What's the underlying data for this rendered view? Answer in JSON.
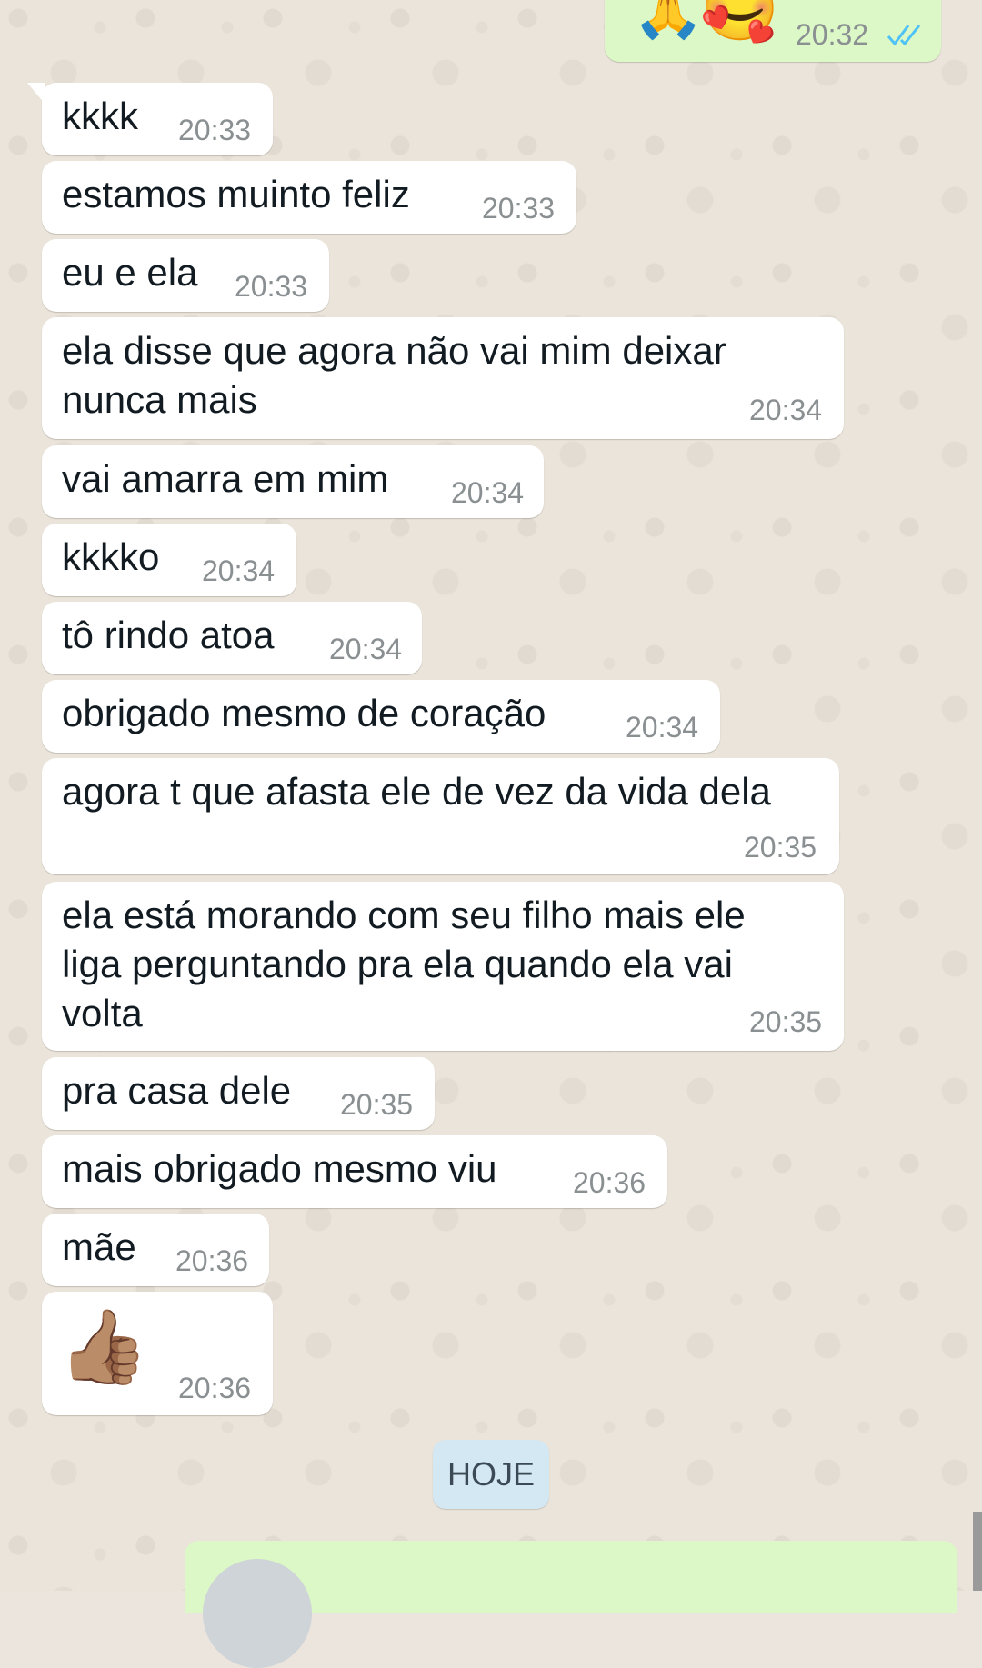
{
  "outgoing_top": {
    "emojis": [
      "🙏",
      "🥰"
    ],
    "time": "20:32",
    "status_icon": "double-check-read-icon"
  },
  "messages": [
    {
      "text": "kkkk",
      "time": "20:33"
    },
    {
      "text": "estamos muinto feliz",
      "time": "20:33"
    },
    {
      "text": "eu e ela",
      "time": "20:33"
    },
    {
      "text": "ela disse que agora não vai mim deixar\nnunca mais",
      "time": "20:34"
    },
    {
      "text": "vai amarra em mim",
      "time": "20:34"
    },
    {
      "text": "kkkko",
      "time": "20:34"
    },
    {
      "text": "tô rindo atoa",
      "time": "20:34"
    },
    {
      "text": "obrigado mesmo de coração",
      "time": "20:34"
    },
    {
      "text": "agora t que afasta ele de vez da vida dela",
      "time": "20:35"
    },
    {
      "text": "ela está morando com seu filho mais ele\nliga perguntando pra ela quando ela vai\nvolta",
      "time": "20:35"
    },
    {
      "text": "pra casa dele",
      "time": "20:35"
    },
    {
      "text": "mais obrigado mesmo viu",
      "time": "20:36"
    },
    {
      "text": "mãe",
      "time": "20:36"
    },
    {
      "text": "👍🏽",
      "time": "20:36"
    }
  ],
  "date_divider": "HOJE"
}
